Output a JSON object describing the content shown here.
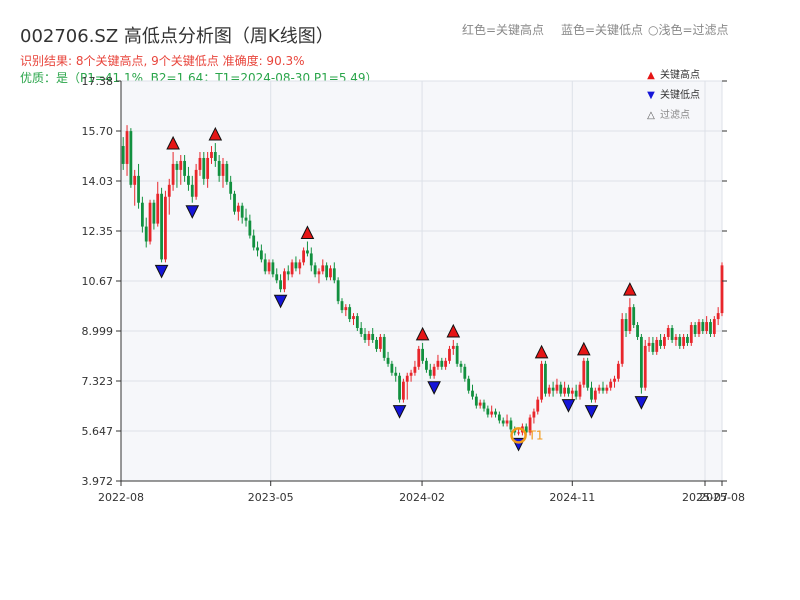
{
  "header": {
    "title": "002706.SZ 高低点分析图（周K线图）",
    "result_line": "识别结果: 8个关键高点, 9个关键低点   准确度: 90.3%",
    "quality_line": "优质：是（P1=41.1%, B2=1.64；T1=2024-08-30 P1=5.49）",
    "legend_red": "红色=关键高点",
    "legend_blue": "蓝色=关键低点",
    "legend_light": "浅色=过滤点"
  },
  "legend": {
    "high": "关键高点",
    "low": "关键低点",
    "filtered": "过滤点"
  },
  "colors": {
    "up": "#e8262b",
    "down": "#12903f",
    "high_marker": "#e51515",
    "low_marker": "#1515d8",
    "t1_marker": "#f29a1a",
    "plot_bg": "#f6f7fa"
  },
  "chart_data": {
    "type": "candlestick",
    "title": "002706.SZ 高低点分析图（周K线图）",
    "ylim": [
      3.972,
      17.38
    ],
    "yticks": [
      "3.972",
      "5.647",
      "7.323",
      "8.999",
      "10.67",
      "12.35",
      "14.03",
      "15.70",
      "17.38"
    ],
    "xticks": [
      "2022-08",
      "2023-05",
      "2024-02",
      "2024-11",
      "2025-07",
      "2025-08"
    ],
    "x_range": [
      "2022-08-01",
      "2025-08-01"
    ],
    "t1_label": "T1",
    "candles": [
      [
        "2022-08-05",
        15.2,
        15.5,
        14.4,
        14.6
      ],
      [
        "2022-08-12",
        14.6,
        15.9,
        14.2,
        15.7
      ],
      [
        "2022-08-19",
        15.7,
        15.8,
        13.8,
        13.9
      ],
      [
        "2022-08-26",
        13.9,
        14.4,
        13.2,
        14.2
      ],
      [
        "2022-09-02",
        14.2,
        14.6,
        13.1,
        13.3
      ],
      [
        "2022-09-09",
        13.3,
        13.5,
        12.3,
        12.5
      ],
      [
        "2022-09-16",
        12.5,
        12.8,
        11.8,
        12.0
      ],
      [
        "2022-09-23",
        12.0,
        13.4,
        11.9,
        13.3
      ],
      [
        "2022-09-30",
        13.3,
        13.4,
        12.4,
        12.6
      ],
      [
        "2022-10-07",
        12.6,
        14.0,
        12.5,
        13.6
      ],
      [
        "2022-10-14",
        13.6,
        13.8,
        11.3,
        11.4
      ],
      [
        "2022-10-21",
        11.4,
        13.7,
        11.3,
        13.5
      ],
      [
        "2022-10-28",
        13.5,
        14.1,
        12.9,
        13.9
      ],
      [
        "2022-11-04",
        13.9,
        15.0,
        13.7,
        14.6
      ],
      [
        "2022-11-11",
        14.6,
        14.7,
        13.8,
        14.4
      ],
      [
        "2022-11-18",
        14.4,
        14.9,
        13.9,
        14.7
      ],
      [
        "2022-11-25",
        14.7,
        14.9,
        14.0,
        14.2
      ],
      [
        "2022-12-02",
        14.2,
        14.5,
        13.7,
        13.9
      ],
      [
        "2022-12-09",
        13.9,
        14.2,
        13.3,
        13.5
      ],
      [
        "2022-12-16",
        13.5,
        14.6,
        13.4,
        14.4
      ],
      [
        "2022-12-23",
        14.4,
        15.0,
        14.2,
        14.8
      ],
      [
        "2022-12-30",
        14.8,
        15.0,
        13.9,
        14.1
      ],
      [
        "2023-01-06",
        14.1,
        15.0,
        13.8,
        14.8
      ],
      [
        "2023-01-13",
        14.8,
        15.2,
        14.6,
        15.0
      ],
      [
        "2023-01-20",
        15.0,
        15.3,
        14.5,
        14.7
      ],
      [
        "2023-01-27",
        14.7,
        14.9,
        14.0,
        14.2
      ],
      [
        "2023-02-03",
        14.2,
        14.8,
        13.8,
        14.6
      ],
      [
        "2023-02-10",
        14.6,
        14.7,
        13.9,
        14.0
      ],
      [
        "2023-02-17",
        14.0,
        14.2,
        13.4,
        13.6
      ],
      [
        "2023-02-24",
        13.6,
        13.7,
        12.9,
        13.0
      ],
      [
        "2023-03-03",
        13.0,
        13.3,
        12.7,
        13.2
      ],
      [
        "2023-03-10",
        13.2,
        13.3,
        12.6,
        12.8
      ],
      [
        "2023-03-17",
        12.8,
        13.1,
        12.5,
        12.7
      ],
      [
        "2023-03-24",
        12.7,
        12.9,
        12.1,
        12.2
      ],
      [
        "2023-03-31",
        12.2,
        12.4,
        11.7,
        11.8
      ],
      [
        "2023-04-07",
        11.8,
        12.0,
        11.5,
        11.7
      ],
      [
        "2023-04-14",
        11.7,
        11.9,
        11.3,
        11.4
      ],
      [
        "2023-04-21",
        11.4,
        11.6,
        10.9,
        11.0
      ],
      [
        "2023-04-28",
        11.0,
        11.4,
        10.9,
        11.3
      ],
      [
        "2023-05-05",
        11.3,
        11.4,
        10.8,
        10.9
      ],
      [
        "2023-05-12",
        10.9,
        11.1,
        10.6,
        10.7
      ],
      [
        "2023-05-19",
        10.7,
        10.9,
        10.3,
        10.4
      ],
      [
        "2023-05-26",
        10.4,
        11.1,
        10.3,
        11.0
      ],
      [
        "2023-06-02",
        11.0,
        11.2,
        10.7,
        10.9
      ],
      [
        "2023-06-09",
        10.9,
        11.4,
        10.8,
        11.3
      ],
      [
        "2023-06-16",
        11.3,
        11.5,
        11.0,
        11.1
      ],
      [
        "2023-06-23",
        11.1,
        11.4,
        10.9,
        11.3
      ],
      [
        "2023-06-30",
        11.3,
        11.8,
        11.2,
        11.7
      ],
      [
        "2023-07-07",
        11.7,
        12.0,
        11.5,
        11.6
      ],
      [
        "2023-07-14",
        11.6,
        11.8,
        11.0,
        11.2
      ],
      [
        "2023-07-21",
        11.2,
        11.3,
        10.8,
        10.9
      ],
      [
        "2023-07-28",
        10.9,
        11.1,
        10.6,
        11.0
      ],
      [
        "2023-08-04",
        11.0,
        11.4,
        10.9,
        11.2
      ],
      [
        "2023-08-11",
        11.2,
        11.3,
        10.7,
        10.8
      ],
      [
        "2023-08-18",
        10.8,
        11.2,
        10.7,
        11.1
      ],
      [
        "2023-08-25",
        11.1,
        11.3,
        10.6,
        10.7
      ],
      [
        "2023-09-01",
        10.7,
        10.8,
        9.9,
        10.0
      ],
      [
        "2023-09-08",
        10.0,
        10.1,
        9.6,
        9.7
      ],
      [
        "2023-09-15",
        9.7,
        9.9,
        9.5,
        9.8
      ],
      [
        "2023-09-22",
        9.8,
        9.9,
        9.3,
        9.4
      ],
      [
        "2023-09-29",
        9.4,
        9.6,
        9.2,
        9.5
      ],
      [
        "2023-10-06",
        9.5,
        9.6,
        9.0,
        9.1
      ],
      [
        "2023-10-13",
        9.1,
        9.3,
        8.8,
        8.9
      ],
      [
        "2023-10-20",
        8.9,
        9.1,
        8.6,
        8.7
      ],
      [
        "2023-10-27",
        8.7,
        9.0,
        8.5,
        8.9
      ],
      [
        "2023-11-03",
        8.9,
        9.1,
        8.6,
        8.7
      ],
      [
        "2023-11-10",
        8.7,
        8.8,
        8.3,
        8.4
      ],
      [
        "2023-11-17",
        8.4,
        8.9,
        8.3,
        8.8
      ],
      [
        "2023-11-24",
        8.8,
        8.9,
        8.0,
        8.1
      ],
      [
        "2023-12-01",
        8.1,
        8.3,
        7.8,
        7.9
      ],
      [
        "2023-12-08",
        7.9,
        8.0,
        7.5,
        7.6
      ],
      [
        "2023-12-15",
        7.6,
        7.8,
        7.3,
        7.5
      ],
      [
        "2023-12-22",
        7.5,
        7.6,
        6.6,
        6.7
      ],
      [
        "2023-12-29",
        6.7,
        7.4,
        6.6,
        7.3
      ],
      [
        "2024-01-05",
        7.3,
        7.6,
        6.7,
        7.5
      ],
      [
        "2024-01-12",
        7.5,
        7.7,
        7.3,
        7.6
      ],
      [
        "2024-01-19",
        7.6,
        8.0,
        7.5,
        7.8
      ],
      [
        "2024-01-26",
        7.8,
        8.5,
        7.7,
        8.4
      ],
      [
        "2024-02-02",
        8.4,
        8.6,
        7.9,
        8.0
      ],
      [
        "2024-02-09",
        8.0,
        8.1,
        7.6,
        7.7
      ],
      [
        "2024-02-16",
        7.7,
        7.9,
        7.4,
        7.5
      ],
      [
        "2024-02-23",
        7.5,
        7.9,
        7.4,
        7.8
      ],
      [
        "2024-03-01",
        7.8,
        8.2,
        7.7,
        8.0
      ],
      [
        "2024-03-08",
        8.0,
        8.1,
        7.7,
        7.8
      ],
      [
        "2024-03-15",
        7.8,
        8.1,
        7.7,
        8.0
      ],
      [
        "2024-03-22",
        8.0,
        8.5,
        7.9,
        8.4
      ],
      [
        "2024-03-29",
        8.4,
        8.7,
        8.2,
        8.5
      ],
      [
        "2024-04-05",
        8.5,
        8.6,
        7.8,
        7.9
      ],
      [
        "2024-04-12",
        7.9,
        8.0,
        7.6,
        7.8
      ],
      [
        "2024-04-19",
        7.8,
        7.9,
        7.3,
        7.4
      ],
      [
        "2024-04-26",
        7.4,
        7.5,
        6.9,
        7.0
      ],
      [
        "2024-05-03",
        7.0,
        7.2,
        6.7,
        6.8
      ],
      [
        "2024-05-10",
        6.8,
        6.9,
        6.4,
        6.5
      ],
      [
        "2024-05-17",
        6.5,
        6.7,
        6.4,
        6.6
      ],
      [
        "2024-05-24",
        6.6,
        6.7,
        6.3,
        6.4
      ],
      [
        "2024-05-31",
        6.4,
        6.5,
        6.1,
        6.2
      ],
      [
        "2024-06-07",
        6.2,
        6.5,
        6.1,
        6.3
      ],
      [
        "2024-06-14",
        6.3,
        6.4,
        6.1,
        6.2
      ],
      [
        "2024-06-21",
        6.2,
        6.3,
        5.9,
        6.0
      ],
      [
        "2024-06-28",
        6.0,
        6.1,
        5.8,
        5.9
      ],
      [
        "2024-07-05",
        5.9,
        6.2,
        5.8,
        6.0
      ],
      [
        "2024-07-12",
        6.0,
        6.1,
        5.6,
        5.7
      ],
      [
        "2024-07-19",
        5.7,
        5.8,
        5.5,
        5.6
      ],
      [
        "2024-07-26",
        5.6,
        5.7,
        5.5,
        5.6
      ],
      [
        "2024-08-02",
        5.6,
        5.9,
        5.5,
        5.8
      ],
      [
        "2024-08-09",
        5.8,
        5.9,
        5.5,
        5.6
      ],
      [
        "2024-08-16",
        5.6,
        6.2,
        5.5,
        6.1
      ],
      [
        "2024-08-23",
        6.1,
        6.4,
        5.9,
        6.3
      ],
      [
        "2024-08-30",
        6.3,
        6.8,
        6.2,
        6.7
      ],
      [
        "2024-09-06",
        6.7,
        8.0,
        6.6,
        7.9
      ],
      [
        "2024-09-13",
        7.9,
        8.0,
        6.8,
        6.9
      ],
      [
        "2024-09-20",
        6.9,
        7.2,
        6.8,
        7.1
      ],
      [
        "2024-09-27",
        7.1,
        7.3,
        6.8,
        7.0
      ],
      [
        "2024-10-04",
        7.0,
        7.4,
        6.9,
        7.2
      ],
      [
        "2024-10-11",
        7.2,
        7.3,
        6.8,
        6.9
      ],
      [
        "2024-10-18",
        6.9,
        7.3,
        6.8,
        7.1
      ],
      [
        "2024-10-25",
        7.1,
        7.2,
        6.8,
        6.9
      ],
      [
        "2024-11-01",
        6.9,
        7.1,
        6.7,
        7.0
      ],
      [
        "2024-11-08",
        7.0,
        7.2,
        6.7,
        6.8
      ],
      [
        "2024-11-15",
        6.8,
        7.3,
        6.7,
        7.2
      ],
      [
        "2024-11-22",
        7.2,
        8.1,
        7.1,
        8.0
      ],
      [
        "2024-11-29",
        8.0,
        8.1,
        7.0,
        7.1
      ],
      [
        "2024-12-06",
        7.1,
        7.3,
        6.6,
        6.7
      ],
      [
        "2024-12-13",
        6.7,
        7.1,
        6.6,
        7.0
      ],
      [
        "2024-12-20",
        7.0,
        7.2,
        6.9,
        7.1
      ],
      [
        "2024-12-27",
        7.1,
        7.3,
        6.9,
        7.0
      ],
      [
        "2025-01-03",
        7.0,
        7.2,
        6.9,
        7.1
      ],
      [
        "2025-01-10",
        7.1,
        7.4,
        7.0,
        7.3
      ],
      [
        "2025-01-17",
        7.3,
        7.5,
        7.1,
        7.4
      ],
      [
        "2025-01-24",
        7.4,
        8.0,
        7.3,
        7.9
      ],
      [
        "2025-01-31",
        7.9,
        9.6,
        7.8,
        9.4
      ],
      [
        "2025-02-07",
        9.4,
        9.6,
        8.8,
        9.0
      ],
      [
        "2025-02-14",
        9.0,
        10.1,
        8.9,
        9.8
      ],
      [
        "2025-02-21",
        9.8,
        9.9,
        9.1,
        9.2
      ],
      [
        "2025-02-28",
        9.2,
        9.3,
        8.7,
        8.8
      ],
      [
        "2025-03-07",
        8.8,
        8.9,
        6.9,
        7.1
      ],
      [
        "2025-03-14",
        7.1,
        8.7,
        7.0,
        8.5
      ],
      [
        "2025-03-21",
        8.5,
        8.8,
        8.3,
        8.6
      ],
      [
        "2025-03-28",
        8.6,
        8.8,
        8.2,
        8.3
      ],
      [
        "2025-04-04",
        8.3,
        8.8,
        8.2,
        8.7
      ],
      [
        "2025-04-11",
        8.7,
        8.9,
        8.4,
        8.5
      ],
      [
        "2025-04-18",
        8.5,
        8.9,
        8.4,
        8.8
      ],
      [
        "2025-04-25",
        8.8,
        9.2,
        8.7,
        9.1
      ],
      [
        "2025-05-02",
        9.1,
        9.2,
        8.6,
        8.7
      ],
      [
        "2025-05-09",
        8.7,
        8.9,
        8.5,
        8.8
      ],
      [
        "2025-05-16",
        8.8,
        8.9,
        8.4,
        8.5
      ],
      [
        "2025-05-23",
        8.5,
        8.9,
        8.4,
        8.8
      ],
      [
        "2025-05-30",
        8.8,
        8.9,
        8.5,
        8.6
      ],
      [
        "2025-06-06",
        8.6,
        9.3,
        8.5,
        9.2
      ],
      [
        "2025-06-13",
        9.2,
        9.3,
        8.8,
        8.9
      ],
      [
        "2025-06-20",
        8.9,
        9.4,
        8.8,
        9.3
      ],
      [
        "2025-06-27",
        9.3,
        9.4,
        8.9,
        9.0
      ],
      [
        "2025-07-04",
        9.0,
        9.5,
        8.9,
        9.3
      ],
      [
        "2025-07-11",
        9.3,
        9.4,
        8.8,
        8.9
      ],
      [
        "2025-07-18",
        8.9,
        9.5,
        8.8,
        9.4
      ],
      [
        "2025-07-25",
        9.4,
        9.8,
        9.2,
        9.6
      ],
      [
        "2025-08-01",
        9.6,
        11.3,
        9.5,
        11.2
      ]
    ],
    "key_highs": [
      [
        "2022-11-04",
        15.0
      ],
      [
        "2023-01-20",
        15.3
      ],
      [
        "2023-07-07",
        12.0
      ],
      [
        "2024-02-02",
        8.6
      ],
      [
        "2024-03-29",
        8.7
      ],
      [
        "2024-09-06",
        8.0
      ],
      [
        "2024-11-22",
        8.1
      ],
      [
        "2025-02-14",
        10.1
      ]
    ],
    "key_lows": [
      [
        "2022-10-14",
        11.3
      ],
      [
        "2022-12-09",
        13.3
      ],
      [
        "2023-05-19",
        10.3
      ],
      [
        "2023-12-22",
        6.6
      ],
      [
        "2024-02-23",
        7.4
      ],
      [
        "2024-07-26",
        5.5
      ],
      [
        "2024-10-25",
        6.8
      ],
      [
        "2024-12-06",
        6.6
      ],
      [
        "2025-03-07",
        6.9
      ]
    ],
    "t1": [
      "2024-07-26",
      5.5
    ]
  }
}
